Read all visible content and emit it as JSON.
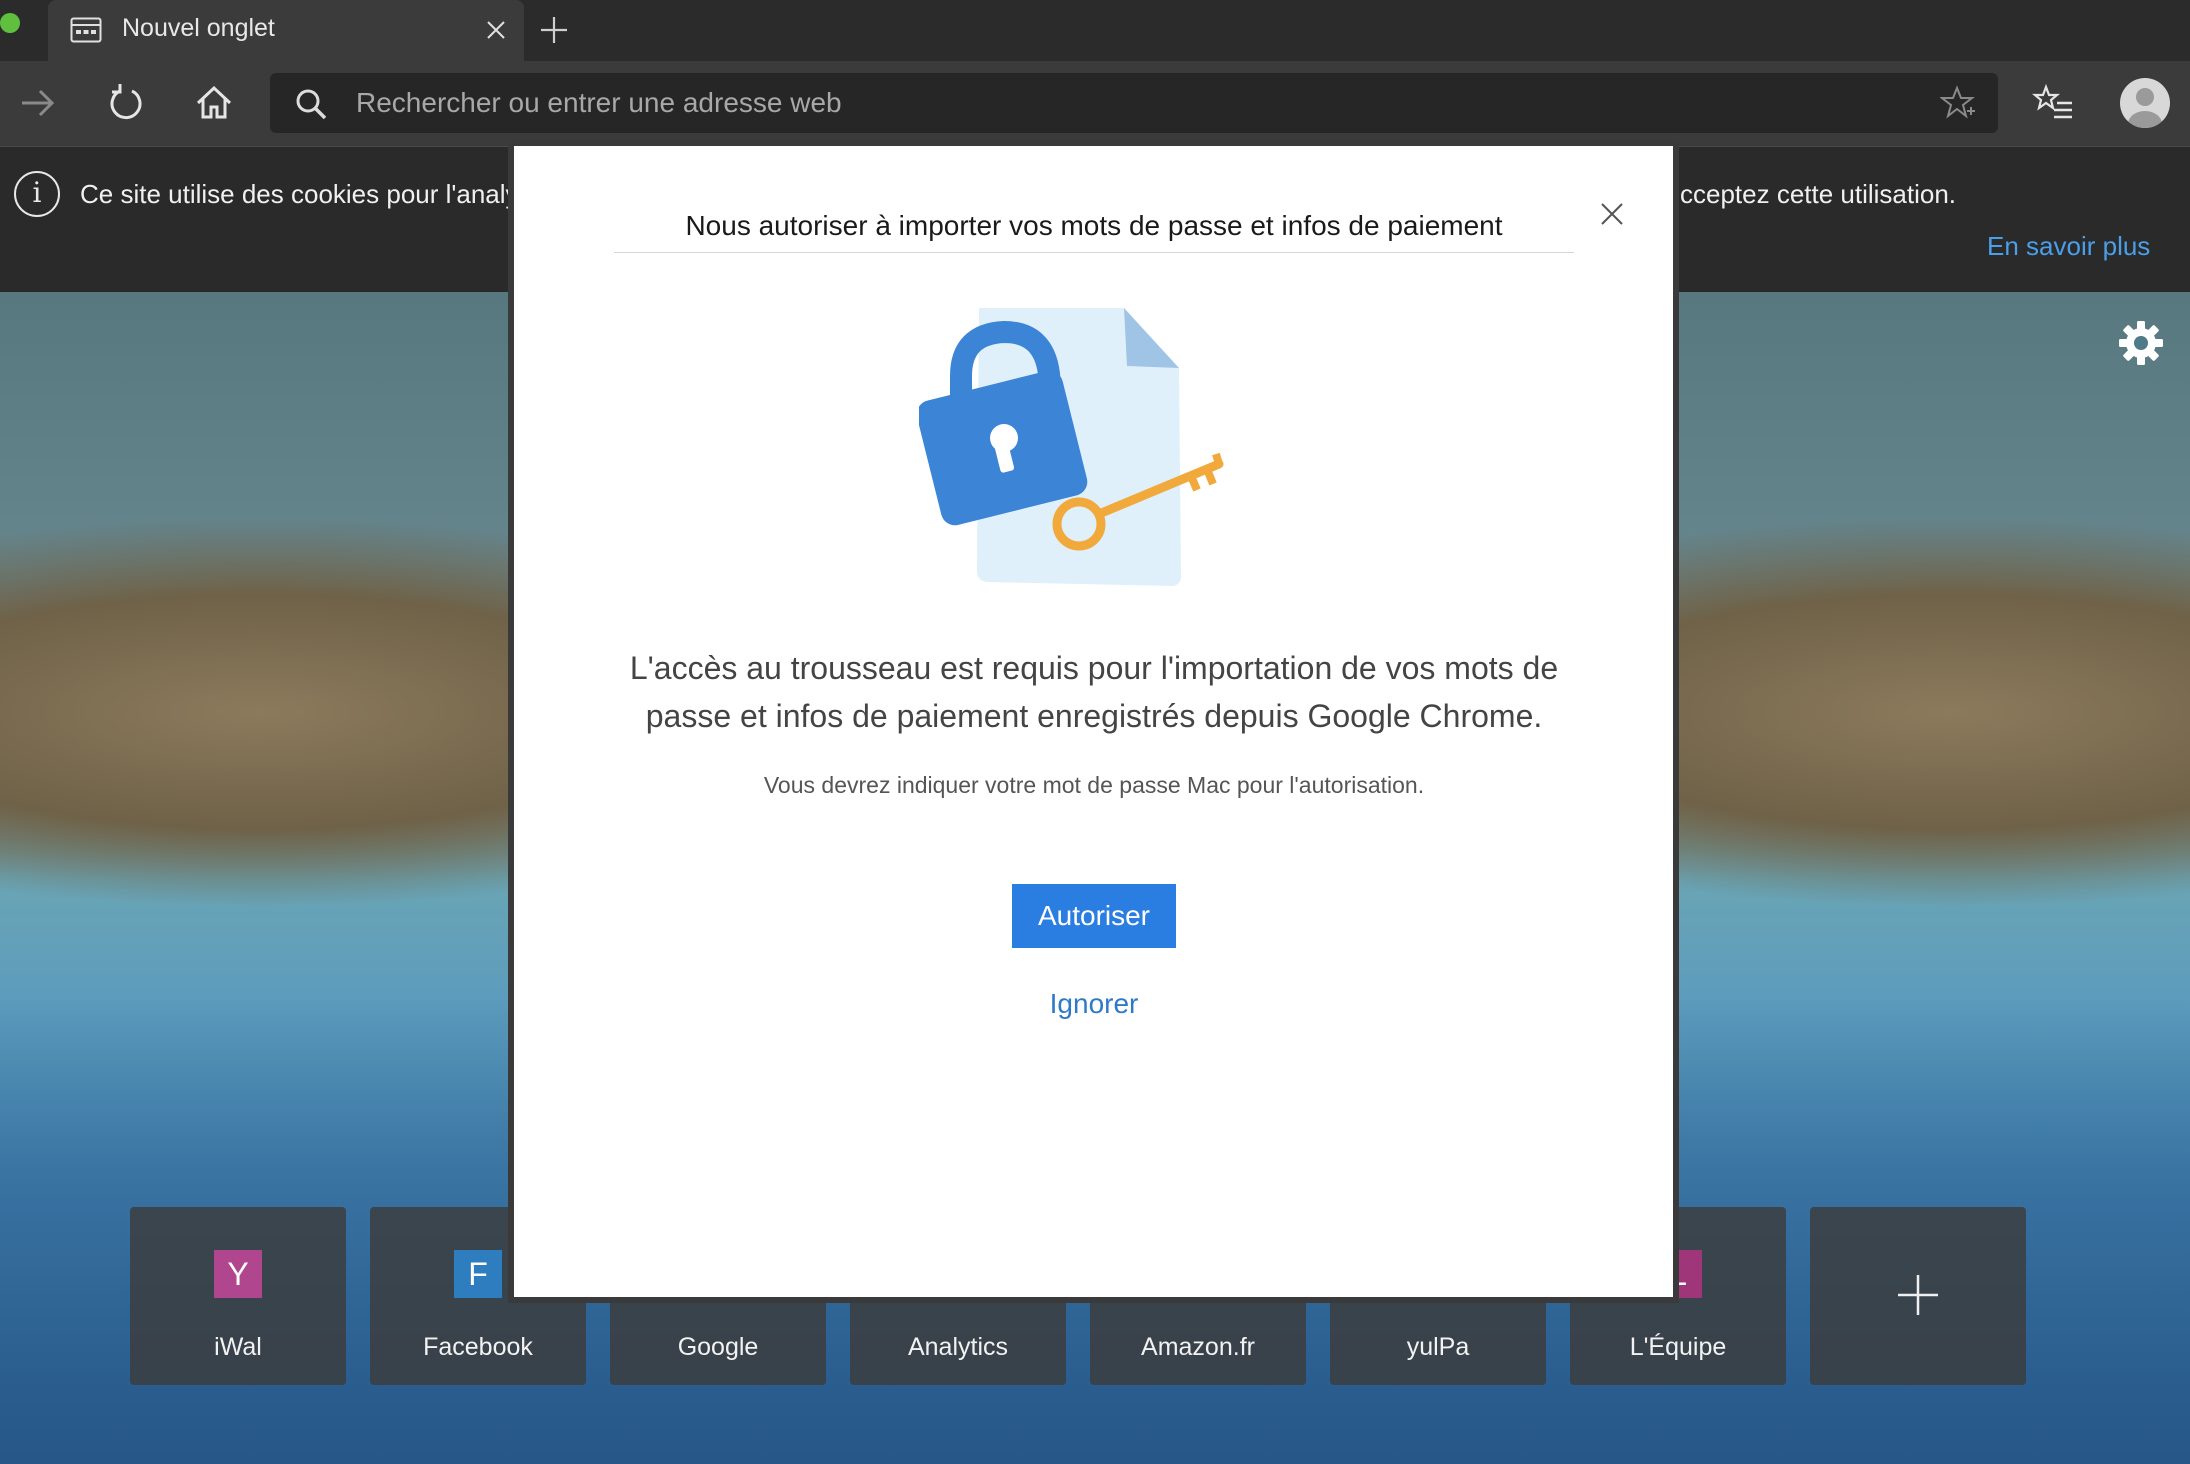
{
  "tab": {
    "title": "Nouvel onglet"
  },
  "address_bar": {
    "placeholder": "Rechercher ou entrer une adresse web"
  },
  "cookie_banner": {
    "text_left": "Ce site utilise des cookies pour l'analy",
    "text_right": "cceptez cette utilisation.",
    "link": "En savoir plus"
  },
  "tiles": [
    {
      "label": "iWal",
      "badge": "Y",
      "color": "#b0468d"
    },
    {
      "label": "Facebook",
      "badge": "F",
      "color": "#2e7dbf"
    },
    {
      "label": "Google",
      "badge": "",
      "color": ""
    },
    {
      "label": "Analytics",
      "badge": "",
      "color": ""
    },
    {
      "label": "Amazon.fr",
      "badge": "",
      "color": ""
    },
    {
      "label": "yulPa",
      "badge": "",
      "color": ""
    },
    {
      "label": "L'Équipe",
      "badge": "L",
      "color": "#a0367a"
    }
  ],
  "dialog": {
    "title": "Nous autoriser à importer vos mots de passe et infos de paiement",
    "message": "L'accès au trousseau est requis pour l'importation de vos mots de passe et infos de paiement enregistrés depuis Google Chrome.",
    "note": "Vous devrez indiquer votre mot de passe Mac pour l'autorisation.",
    "allow_label": "Autoriser",
    "ignore_label": "Ignorer"
  },
  "colors": {
    "accent": "#2a7de1",
    "link": "#4a9fe8",
    "lock": "#3b84d6",
    "key": "#f2a93b"
  }
}
